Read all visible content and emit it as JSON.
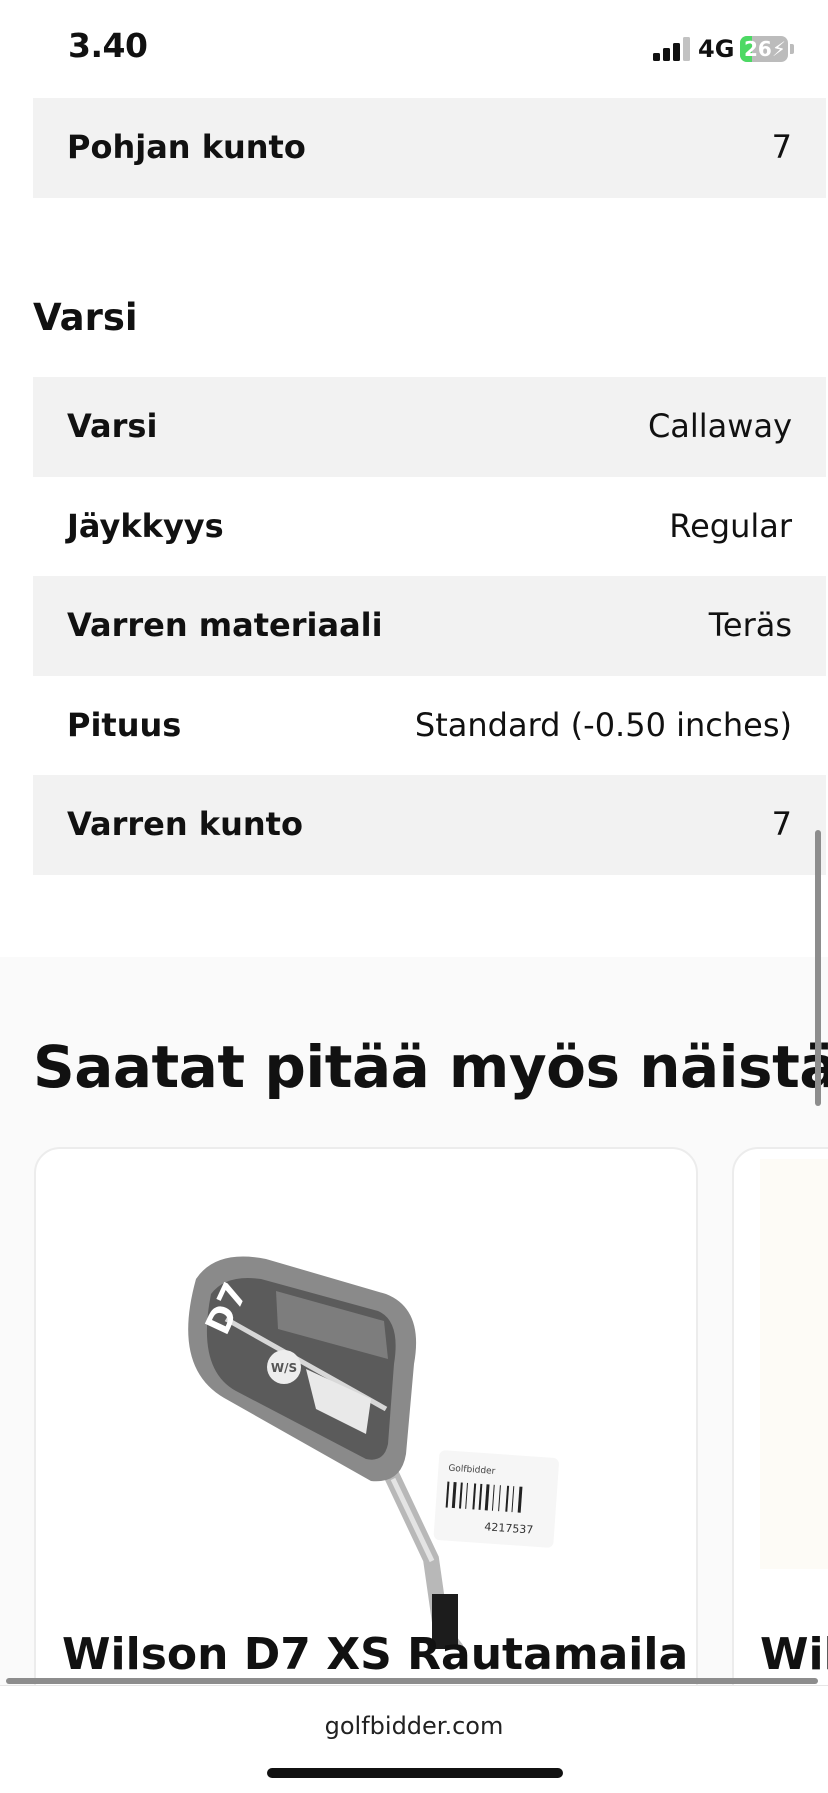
{
  "status_bar": {
    "time": "3.40",
    "network": "4G",
    "battery": "26",
    "battery_level": 0.26
  },
  "top_row": {
    "label": "Pohjan kunto",
    "value": "7"
  },
  "shaft_section": {
    "heading": "Varsi",
    "rows": [
      {
        "label": "Varsi",
        "value": "Callaway"
      },
      {
        "label": "Jäykkyys",
        "value": "Regular"
      },
      {
        "label": "Varren materiaali",
        "value": "Teräs"
      },
      {
        "label": "Pituus",
        "value": "Standard (-0.50 inches)"
      },
      {
        "label": "Varren kunto",
        "value": "7"
      }
    ]
  },
  "recommendations": {
    "title": "Saatat pitää myös näistä",
    "cards": [
      {
        "title": "Wilson D7 XS Rautamaila",
        "image_icon": "golf-iron-image",
        "head_logo": "W/S",
        "head_mark": "D7",
        "tag_brand": "Golfbidder",
        "tag_number": "4217537"
      },
      {
        "title": "Wil",
        "image_icon": "product-image"
      }
    ]
  },
  "browser": {
    "url": "golfbidder.com"
  }
}
